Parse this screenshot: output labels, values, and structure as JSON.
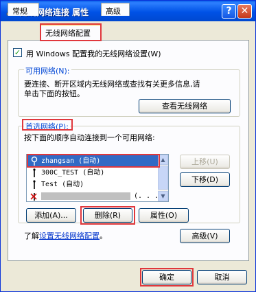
{
  "window": {
    "title": "无线网络连接 属性",
    "help_glyph": "?",
    "close_glyph": "✕"
  },
  "tabs": [
    {
      "label": "常规"
    },
    {
      "label": "无线网络配置"
    },
    {
      "label": "高级"
    }
  ],
  "wireless_config": {
    "use_windows_label": "用 Windows 配置我的无线网络设置(W)",
    "use_windows_checked": true,
    "checkmark": "✓"
  },
  "available_networks": {
    "title": "可用网络(N):",
    "description_line1": "要连接、断开区域内无线网络或查找有关更多信息,请",
    "description_line2": "单击下面的按钮。",
    "view_button": "查看无线网络"
  },
  "preferred_networks": {
    "title": "首选网络(P):",
    "instruction": "按下面的顺序自动连接到一个可用网络:",
    "items": [
      {
        "name": "zhangsan (自动)",
        "selected": true
      },
      {
        "name": "300C_TEST (自动)",
        "selected": false
      },
      {
        "name": "Test (自动)",
        "selected": false
      },
      {
        "name": "(. . .",
        "selected": false
      }
    ],
    "move_up": "上移(U)",
    "move_down": "下移(D)",
    "add": "添加(A)...",
    "remove": "删除(R)",
    "properties": "属性(O)"
  },
  "learn_more": {
    "prefix": "了解",
    "link": "设置无线网络配置",
    "suffix": "。",
    "advanced_button": "高级(V)"
  },
  "footer": {
    "ok": "确定",
    "cancel": "取消"
  },
  "colors": {
    "highlight_border": "#e0373c",
    "selection": "#316ac5",
    "group_title": "#0046d5"
  }
}
